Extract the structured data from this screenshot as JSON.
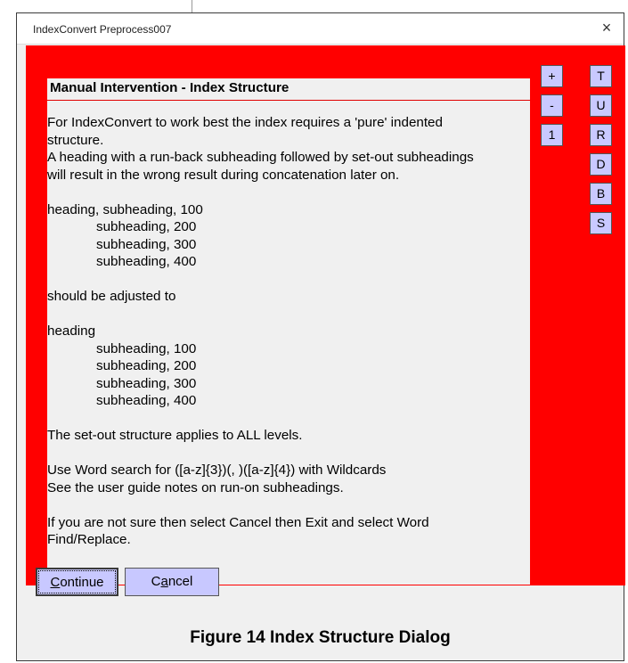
{
  "window": {
    "title": "IndexConvert Preprocess007",
    "close_glyph": "×"
  },
  "dialog": {
    "heading": "Manual Intervention - Index Structure",
    "lines": [
      {
        "text": "For IndexConvert to work best the index requires a 'pure' indented",
        "indent": false
      },
      {
        "text": "structure.",
        "indent": false
      },
      {
        "text": "A heading with a run-back subheading followed by set-out subheadings",
        "indent": false
      },
      {
        "text": "will result in the wrong result during concatenation later on.",
        "indent": false
      },
      {
        "text": "",
        "indent": false
      },
      {
        "text": "heading, subheading, 100",
        "indent": false
      },
      {
        "text": "subheading, 200",
        "indent": true
      },
      {
        "text": "subheading, 300",
        "indent": true
      },
      {
        "text": "subheading, 400",
        "indent": true
      },
      {
        "text": "",
        "indent": false
      },
      {
        "text": "should be adjusted to",
        "indent": false
      },
      {
        "text": "",
        "indent": false
      },
      {
        "text": "heading",
        "indent": false
      },
      {
        "text": "subheading, 100",
        "indent": true
      },
      {
        "text": "subheading, 200",
        "indent": true
      },
      {
        "text": "subheading, 300",
        "indent": true
      },
      {
        "text": "subheading, 400",
        "indent": true
      },
      {
        "text": "",
        "indent": false
      },
      {
        "text": "The set-out structure applies to ALL levels.",
        "indent": false
      },
      {
        "text": "",
        "indent": false
      },
      {
        "text": "Use Word search for ([a-z]{3})(, )([a-z]{4}) with Wildcards",
        "indent": false
      },
      {
        "text": "See the user guide notes on run-on subheadings.",
        "indent": false
      },
      {
        "text": "",
        "indent": false
      },
      {
        "text": "If you are not sure then select Cancel then Exit and select Word",
        "indent": false
      },
      {
        "text": "Find/Replace.",
        "indent": false
      }
    ]
  },
  "zoom_buttons": {
    "plus": "+",
    "minus": "-",
    "one": "1"
  },
  "letter_buttons": {
    "t": "T",
    "u": "U",
    "r": "R",
    "d": "D",
    "b": "B",
    "s": "S"
  },
  "buttons": {
    "continue_ul": "C",
    "continue_rest": "ontinue",
    "cancel_pre": "C",
    "cancel_ul": "a",
    "cancel_rest": "ncel"
  },
  "caption": "Figure 14 Index Structure Dialog",
  "colors": {
    "panel": "#ff0000",
    "button": "#c9c9ff"
  }
}
